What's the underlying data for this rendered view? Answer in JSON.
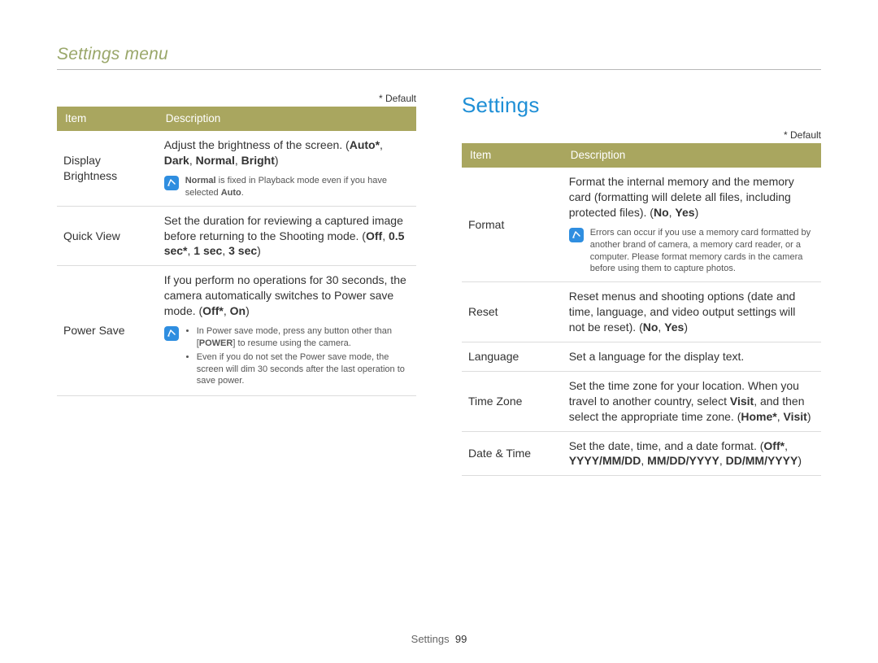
{
  "header": {
    "section": "Settings menu"
  },
  "title": "Settings",
  "default_caption": "* Default",
  "table_headers": {
    "item": "Item",
    "description": "Description"
  },
  "left": {
    "rows": [
      {
        "item": "Display Brightness",
        "desc_pre": "Adjust the brightness of the screen. (",
        "opts": [
          "Auto*",
          "Dark",
          "Normal",
          "Bright"
        ],
        "desc_post": ")",
        "note": {
          "pre": "",
          "bold1": "Normal",
          "mid": " is fixed in Playback mode even if you have selected ",
          "bold2": "Auto",
          "post": "."
        }
      },
      {
        "item": "Quick View",
        "desc_pre": "Set the duration for reviewing a captured image before returning to the Shooting mode. (",
        "opts": [
          "Off",
          "0.5 sec*",
          "1 sec",
          "3 sec"
        ],
        "desc_post": ")"
      },
      {
        "item": "Power Save",
        "desc_pre": "If you perform no operations for 30 seconds, the camera automatically switches to Power save mode. (",
        "opts": [
          "Off*",
          "On"
        ],
        "desc_post": ")",
        "note_list": [
          {
            "pre": "In Power save mode, press any button other than [",
            "bold": "POWER",
            "post": "] to resume using the camera."
          },
          {
            "text": "Even if you do not set the Power save mode, the screen will dim 30 seconds after the last operation to save power."
          }
        ]
      }
    ]
  },
  "right": {
    "rows": [
      {
        "item": "Format",
        "desc_pre": "Format the internal memory and the memory card (formatting will delete all files, including protected files). (",
        "opts": [
          "No",
          "Yes"
        ],
        "desc_post": ")",
        "note_plain": "Errors can occur if you use a memory card formatted by another brand of camera, a memory card reader, or a computer. Please format memory cards in the camera before using them to capture photos."
      },
      {
        "item": "Reset",
        "desc_pre": "Reset menus and shooting options (date and time, language, and video output settings will not be reset). (",
        "opts": [
          "No",
          "Yes"
        ],
        "desc_post": ")"
      },
      {
        "item": "Language",
        "desc_plain": "Set a language for the display text."
      },
      {
        "item": "Time Zone",
        "tz_pre": "Set the time zone for your location. When you travel to another country, select ",
        "tz_visit": "Visit",
        "tz_mid": ", and then select the appropriate time zone. (",
        "opts": [
          "Home*",
          "Visit"
        ],
        "desc_post": ")"
      },
      {
        "item": "Date & Time",
        "desc_pre": "Set the date, time, and a date format. (",
        "opts": [
          "Off*",
          "YYYY/MM/DD",
          "MM/DD/YYYY",
          "DD/MM/YYYY"
        ],
        "desc_post": ")"
      }
    ]
  },
  "footer": {
    "label": "Settings",
    "page": "99"
  },
  "sep": ", "
}
